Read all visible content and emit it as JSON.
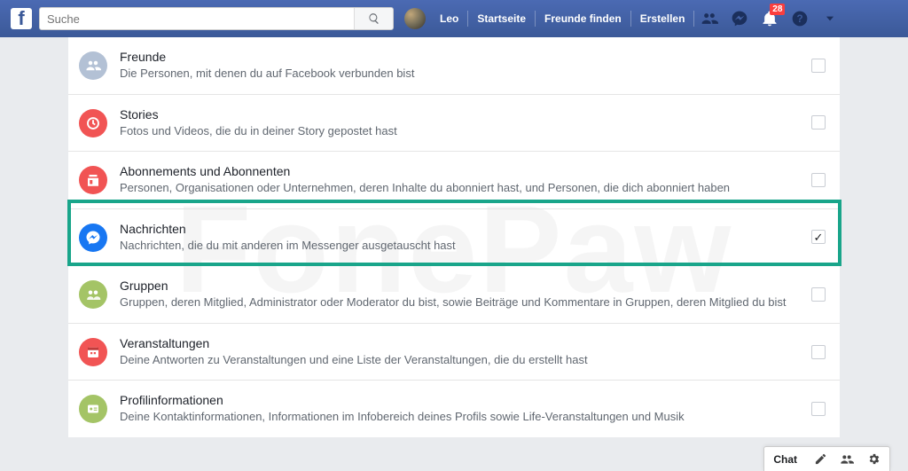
{
  "header": {
    "search_placeholder": "Suche",
    "user_name": "Leo",
    "nav": {
      "home": "Startseite",
      "find_friends": "Freunde finden",
      "create": "Erstellen"
    },
    "notifications_count": "28"
  },
  "watermark": "FonePaw",
  "rows": [
    {
      "key": "friends",
      "icon_bg": "#b3c1d5",
      "title": "Freunde",
      "desc": "Die Personen, mit denen du auf Facebook verbunden bist",
      "checked": false
    },
    {
      "key": "stories",
      "icon_bg": "#f15454",
      "title": "Stories",
      "desc": "Fotos und Videos, die du in deiner Story gepostet hast",
      "checked": false
    },
    {
      "key": "follows",
      "icon_bg": "#f15454",
      "title": "Abonnements und Abonnenten",
      "desc": "Personen, Organisationen oder Unternehmen, deren Inhalte du abonniert hast, und Personen, die dich abonniert haben",
      "checked": false
    },
    {
      "key": "messages",
      "icon_bg": "#1877f2",
      "title": "Nachrichten",
      "desc": "Nachrichten, die du mit anderen im Messenger ausgetauscht hast",
      "checked": true
    },
    {
      "key": "groups",
      "icon_bg": "#a4c466",
      "title": "Gruppen",
      "desc": "Gruppen, deren Mitglied, Administrator oder Moderator du bist, sowie Beiträge und Kommentare in Gruppen, deren Mitglied du bist",
      "checked": false
    },
    {
      "key": "events",
      "icon_bg": "#f15454",
      "title": "Veranstaltungen",
      "desc": "Deine Antworten zu Veranstaltungen und eine Liste der Veranstaltungen, die du erstellt hast",
      "checked": false
    },
    {
      "key": "profile",
      "icon_bg": "#a4c466",
      "title": "Profilinformationen",
      "desc": "Deine Kontaktinformationen, Informationen im Infobereich deines Profils sowie Life-Veranstaltungen und Musik",
      "checked": false
    }
  ],
  "chat": {
    "label": "Chat"
  }
}
